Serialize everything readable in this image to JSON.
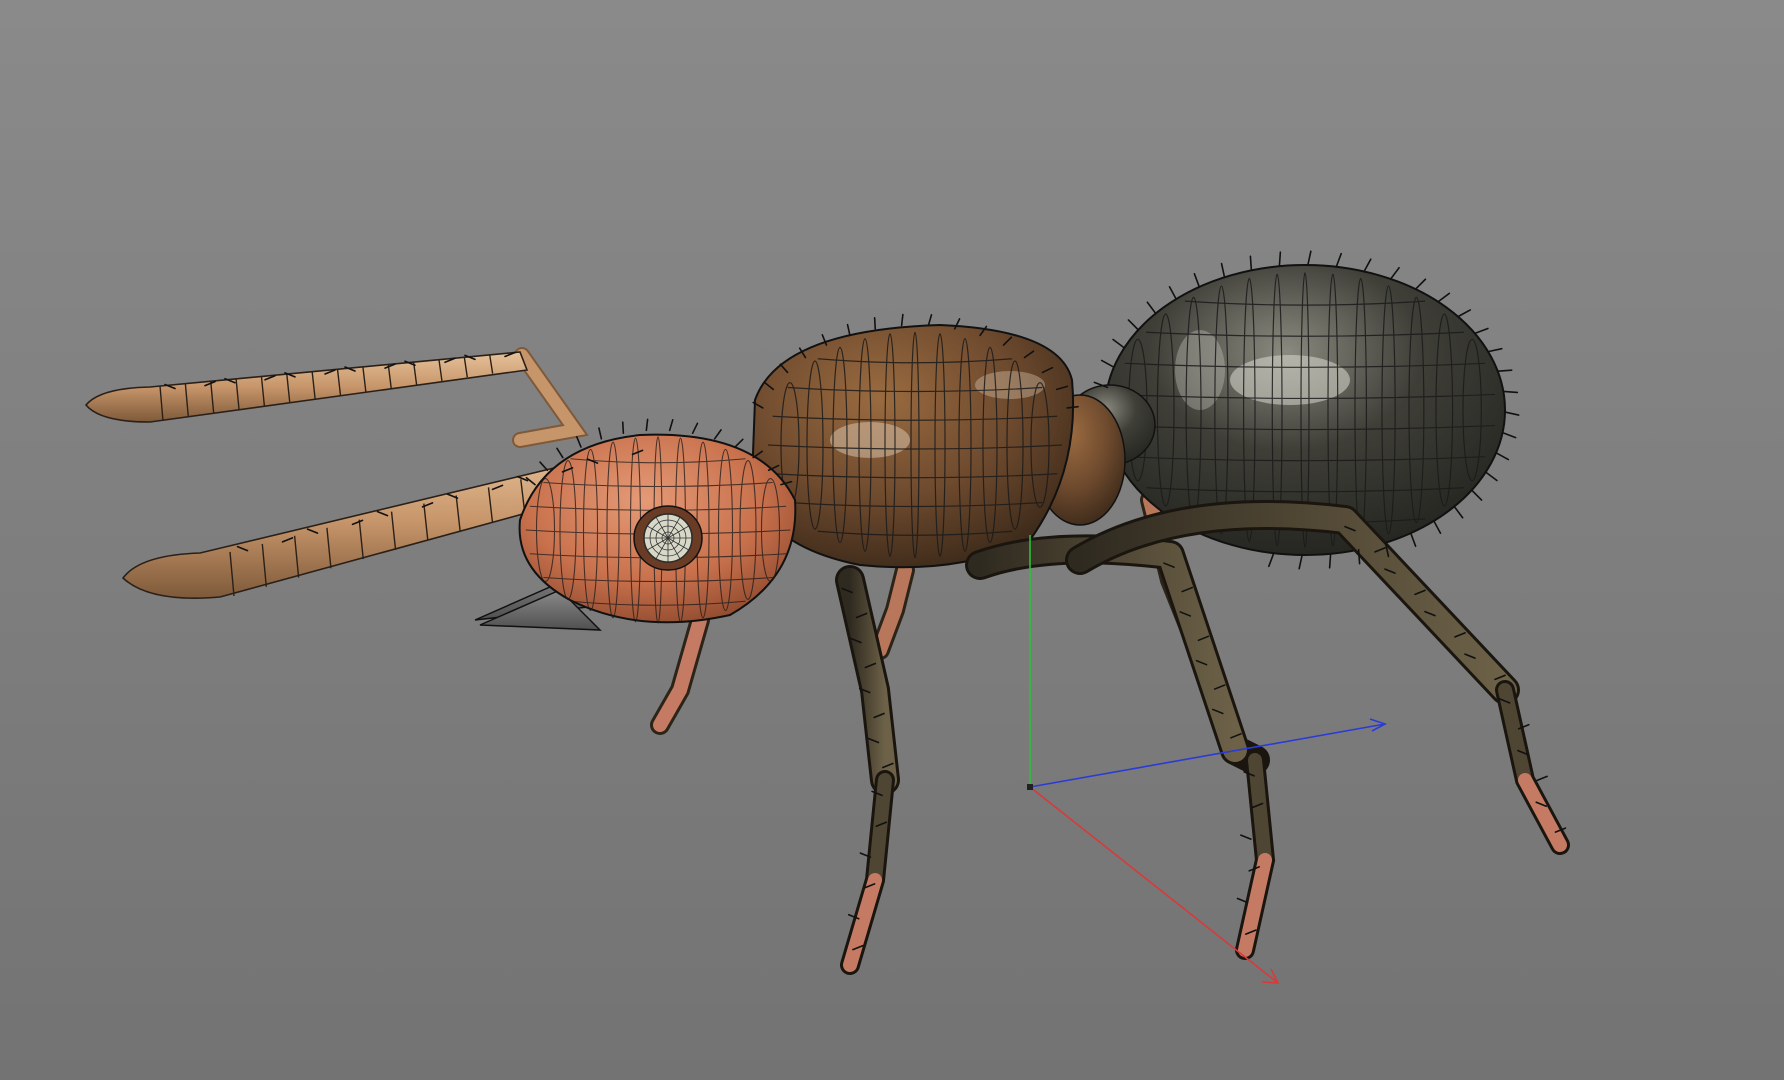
{
  "viewport": {
    "background_top": "#8a8a8a",
    "background_bottom": "#737373"
  },
  "model": {
    "head_color": "#c9714d",
    "head_shadow": "#8f4a2e",
    "thorax_color": "#6e4a2e",
    "thorax_shadow": "#3b2919",
    "gaster_color": "#3f3f38",
    "gaster_shadow": "#23231f",
    "antenna_color": "#c7956a",
    "leg_color": "#4e4533",
    "leg_tip_color": "#c57a63",
    "mandible_color": "#505050",
    "eye_color": "#d8d8c8",
    "wire_color": "#1a1a1a",
    "hair_color": "#111111"
  },
  "gizmo": {
    "axis_y_color": "#2fbf3a",
    "axis_z_color": "#2b3bd6",
    "axis_x_color": "#d83a3a",
    "origin_color": "#222222"
  }
}
